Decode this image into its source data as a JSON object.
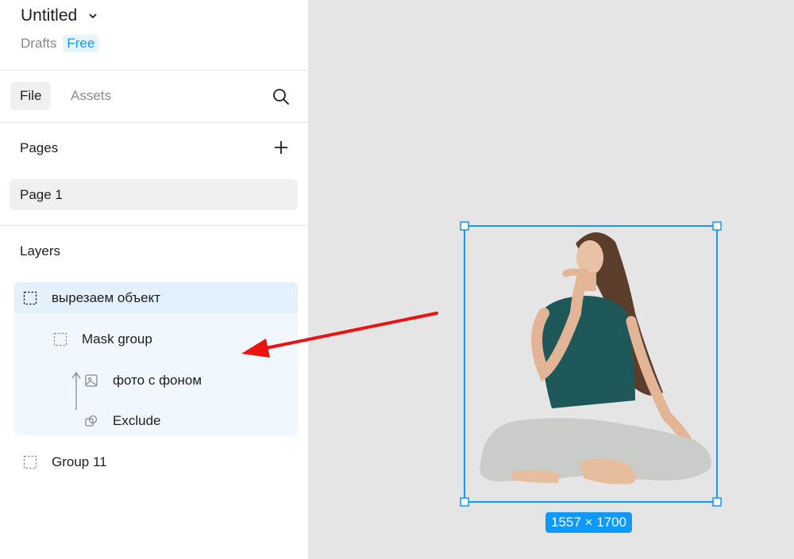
{
  "file": {
    "title": "Untitled",
    "location": "Drafts",
    "plan": "Free"
  },
  "tabs": {
    "file": "File",
    "assets": "Assets"
  },
  "pages": {
    "title": "Pages",
    "items": [
      {
        "label": "Page 1"
      }
    ]
  },
  "layers": {
    "title": "Layers",
    "items": [
      {
        "label": "вырезаем объект",
        "icon": "frame-icon"
      },
      {
        "label": "Mask group",
        "icon": "frame-icon"
      },
      {
        "label": "фото с фоном",
        "icon": "image-icon"
      },
      {
        "label": "Exclude",
        "icon": "boolean-exclude-icon"
      },
      {
        "label": "Group 11",
        "icon": "frame-icon"
      }
    ]
  },
  "canvas": {
    "selection_size": "1557 × 1700",
    "annotation_color": "#ee1111",
    "selection_color": "#0d99ff"
  }
}
